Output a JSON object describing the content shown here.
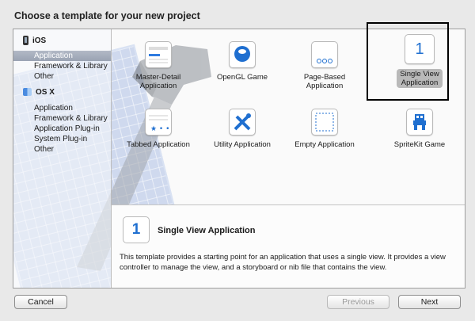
{
  "window": {
    "title": "Choose a template for your new project"
  },
  "sidebar": {
    "sections": [
      {
        "header": "iOS",
        "icon": "iphone-icon",
        "items": [
          "Application",
          "Framework & Library",
          "Other"
        ],
        "selected": 0
      },
      {
        "header": "OS X",
        "icon": "finder-icon",
        "items": [
          "Application",
          "Framework & Library",
          "Application Plug-in",
          "System Plug-in",
          "Other"
        ],
        "selected": -1
      }
    ]
  },
  "templates": [
    {
      "label": "Master-Detail\nApplication",
      "icon": "master-detail-icon"
    },
    {
      "label": "OpenGL Game",
      "icon": "opengl-icon"
    },
    {
      "label": "Page-Based\nApplication",
      "icon": "page-based-icon"
    },
    {
      "label": "Single View\nApplication",
      "icon": "single-view-icon",
      "glyph": "1",
      "selected": true
    },
    {
      "label": "Tabbed Application",
      "icon": "tabbed-icon"
    },
    {
      "label": "Utility Application",
      "icon": "utility-icon"
    },
    {
      "label": "Empty Application",
      "icon": "empty-icon"
    },
    {
      "label": "SpriteKit Game",
      "icon": "spritekit-icon"
    }
  ],
  "detail": {
    "glyph": "1",
    "title": "Single View Application",
    "description": "This template provides a starting point for an application that uses a single view. It provides a view controller to manage the view, and a storyboard or nib file that contains the view."
  },
  "buttons": {
    "cancel": "Cancel",
    "previous": "Previous",
    "next": "Next"
  },
  "colors": {
    "accent": "#1f6fd0",
    "selection": "#9aa3b3",
    "highlight_frame": "#000000"
  }
}
